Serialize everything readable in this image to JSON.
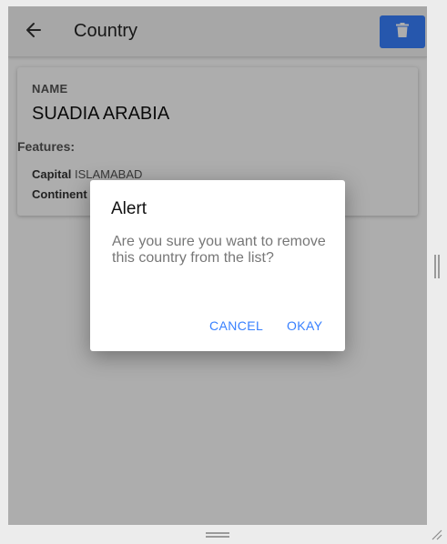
{
  "toolbar": {
    "back_icon": "arrow-left-icon",
    "title": "Country",
    "delete_icon": "trash-icon",
    "delete_color": "#3880ff"
  },
  "country": {
    "name_label": "NAME",
    "name_value": "SUADIA ARABIA",
    "features_label": "Features:",
    "features": [
      {
        "key": "Capital",
        "value": "ISLAMABAD"
      },
      {
        "key": "Continent",
        "value": ""
      }
    ]
  },
  "alert": {
    "title": "Alert",
    "message": "Are you sure you want to remove this country from the list?",
    "cancel_label": "CANCEL",
    "okay_label": "OKAY",
    "accent": "#3880ff"
  }
}
